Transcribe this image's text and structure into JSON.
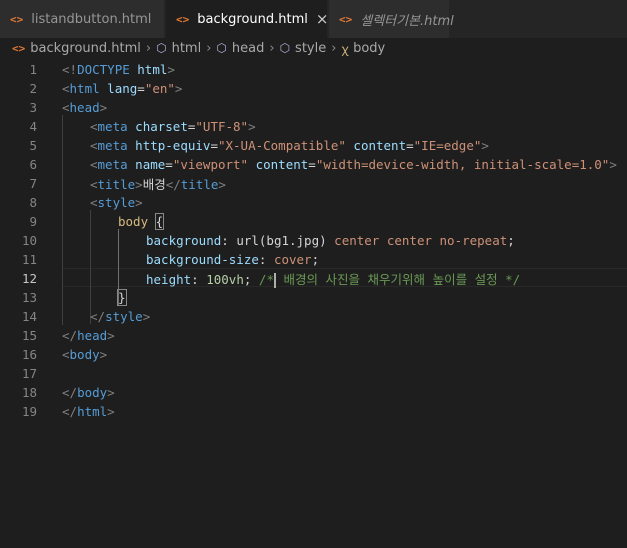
{
  "tabs": [
    {
      "label": "listandbutton.html",
      "icon": "html-file-icon",
      "active": false,
      "italic": false
    },
    {
      "label": "background.html",
      "icon": "html-file-icon",
      "active": true,
      "italic": false,
      "close": "×"
    },
    {
      "label": "셀렉터기본.html",
      "icon": "html-file-icon",
      "active": false,
      "italic": true
    }
  ],
  "breadcrumb": {
    "file": "background.html",
    "items": [
      "html",
      "head",
      "style",
      "body"
    ]
  },
  "editor": {
    "active_line": 12,
    "line_numbers": [
      "1",
      "2",
      "3",
      "4",
      "5",
      "6",
      "7",
      "8",
      "9",
      "10",
      "11",
      "12",
      "13",
      "14",
      "15",
      "16",
      "17",
      "18",
      "19"
    ],
    "lines": {
      "l1": {
        "a": "<!",
        "b": "DOCTYPE",
        "c": " html",
        "d": ">"
      },
      "l2": {
        "a": "<",
        "b": "html",
        "c": " lang",
        "d": "=",
        "e": "\"en\"",
        "f": ">"
      },
      "l3": {
        "a": "<",
        "b": "head",
        "c": ">"
      },
      "l4": {
        "a": "<",
        "b": "meta",
        "c": " charset",
        "d": "=",
        "e": "\"UTF-8\"",
        "f": ">"
      },
      "l5": {
        "a": "<",
        "b": "meta",
        "c": " http-equiv",
        "d": "=",
        "e": "\"X-UA-Compatible\"",
        "f": " content",
        "g": "=",
        "h": "\"IE=edge\"",
        "i": ">"
      },
      "l6": {
        "a": "<",
        "b": "meta",
        "c": " name",
        "d": "=",
        "e": "\"viewport\"",
        "f": " content",
        "g": "=",
        "h": "\"width=device-width, initial-scale=1.0\"",
        "i": ">"
      },
      "l7": {
        "a": "<",
        "b": "title",
        "c": ">",
        "d": "배경",
        "e": "</",
        "f": "title",
        "g": ">"
      },
      "l8": {
        "a": "<",
        "b": "style",
        "c": ">"
      },
      "l9": {
        "a": "body ",
        "b": "{"
      },
      "l10": {
        "a": "background",
        "b": ": ",
        "c": "url(bg1.jpg)",
        "d": " center center no-repeat",
        "e": ";"
      },
      "l11": {
        "a": "background-size",
        "b": ": ",
        "c": "cover",
        "d": ";"
      },
      "l12": {
        "a": "height",
        "b": ": ",
        "c": "100vh",
        "d": "; ",
        "e": "/*",
        "f": " 배경의 사진을 채우기위해 높이를 설정 */"
      },
      "l13": {
        "a": "}"
      },
      "l14": {
        "a": "</",
        "b": "style",
        "c": ">"
      },
      "l15": {
        "a": "</",
        "b": "head",
        "c": ">"
      },
      "l16": {
        "a": "<",
        "b": "body",
        "c": ">"
      },
      "l18": {
        "a": "</",
        "b": "body",
        "c": ">"
      },
      "l19": {
        "a": "</",
        "b": "html",
        "c": ">"
      }
    }
  },
  "colors": {
    "background": "#1e1e1e",
    "tab_inactive": "#2d2d2d",
    "html_icon": "#e37933",
    "tag": "#569cd6",
    "attribute": "#9cdcfe",
    "string": "#ce9178",
    "comment": "#6a9955",
    "selector": "#d7ba7d"
  }
}
